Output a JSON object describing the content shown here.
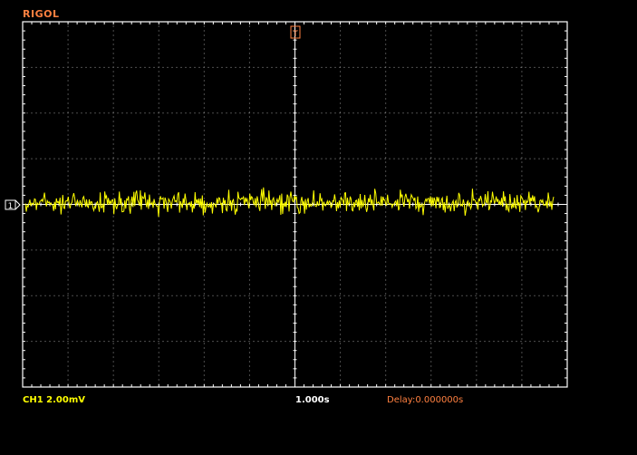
{
  "header": {
    "brand": "RIGOL"
  },
  "markers": {
    "trigger_position_glyph": "T",
    "channel_glyph": "1"
  },
  "status_bar": {
    "channel_scale": "CH1 2.00mV",
    "timebase": "1.000s",
    "delay": "Delay:0.000000s"
  },
  "colors": {
    "background": "#000000",
    "grid_frame": "#ffffff",
    "grid_dots": "#9a9a9a",
    "trace": "#ffff00",
    "brand": "#ff8040",
    "trigger_marker": "#ff8040",
    "channel_text": "#ffff00",
    "timebase_text": "#ffffff",
    "delay_text": "#ff8040"
  },
  "chart_data": {
    "type": "line",
    "title": "",
    "xlabel": "",
    "ylabel": "",
    "grid": true,
    "divisions": {
      "horizontal": 12,
      "vertical": 8
    },
    "xlim": [
      -6,
      6
    ],
    "ylim": [
      -4,
      4
    ],
    "trace": {
      "name": "",
      "level_div": 0,
      "noise_peak_div": 0.25,
      "samples": 580
    }
  }
}
